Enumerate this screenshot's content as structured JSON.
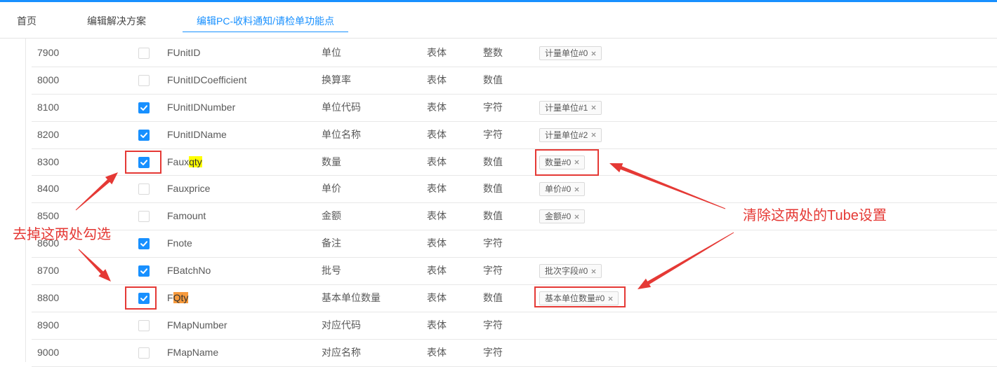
{
  "colors": {
    "accent": "#1890ff",
    "annotation": "#e53935",
    "highlight_yellow": "#ffff00",
    "highlight_orange": "#f79a3c"
  },
  "icons": {
    "tag_remove": "close-icon",
    "checkbox_mark": "check-icon"
  },
  "tabs": [
    {
      "label": "首页",
      "active": false
    },
    {
      "label": "编辑解决方案",
      "active": false
    },
    {
      "label": "编辑PC-收料通知/请检单功能点",
      "active": true
    }
  ],
  "rows": [
    {
      "seq": "7900",
      "checked": false,
      "field": "FUnitID",
      "name": "单位",
      "section": "表体",
      "type": "整数",
      "tag": "计量单位#0"
    },
    {
      "seq": "8000",
      "checked": false,
      "field": "FUnitIDCoefficient",
      "name": "换算率",
      "section": "表体",
      "type": "数值"
    },
    {
      "seq": "8100",
      "checked": true,
      "field": "FUnitIDNumber",
      "name": "单位代码",
      "section": "表体",
      "type": "字符",
      "tag": "计量单位#1"
    },
    {
      "seq": "8200",
      "checked": true,
      "field": "FUnitIDName",
      "name": "单位名称",
      "section": "表体",
      "type": "字符",
      "tag": "计量单位#2"
    },
    {
      "seq": "8300",
      "checked": true,
      "field_prefix": "Faux",
      "field_mark": "qty",
      "name": "数量",
      "section": "表体",
      "type": "数值",
      "tag": "数量#0"
    },
    {
      "seq": "8400",
      "checked": false,
      "field": "Fauxprice",
      "name": "单价",
      "section": "表体",
      "type": "数值",
      "tag": "单价#0"
    },
    {
      "seq": "8500",
      "checked": false,
      "field": "Famount",
      "name": "金额",
      "section": "表体",
      "type": "数值",
      "tag": "金额#0"
    },
    {
      "seq": "8600",
      "checked": true,
      "field": "Fnote",
      "name": "备注",
      "section": "表体",
      "type": "字符"
    },
    {
      "seq": "8700",
      "checked": true,
      "field": "FBatchNo",
      "name": "批号",
      "section": "表体",
      "type": "字符",
      "tag": "批次字段#0"
    },
    {
      "seq": "8800",
      "checked": true,
      "field_prefix": "F",
      "field_mark": "Qty",
      "name": "基本单位数量",
      "section": "表体",
      "type": "数值",
      "tag": "基本单位数量#0"
    },
    {
      "seq": "8900",
      "checked": false,
      "field": "FMapNumber",
      "name": "对应代码",
      "section": "表体",
      "type": "字符"
    },
    {
      "seq": "9000",
      "checked": false,
      "field": "FMapName",
      "name": "对应名称",
      "section": "表体",
      "type": "字符"
    }
  ],
  "annotations": {
    "left_note": "去掉这两处勾选",
    "right_note": "清除这两处的Tube设置"
  }
}
